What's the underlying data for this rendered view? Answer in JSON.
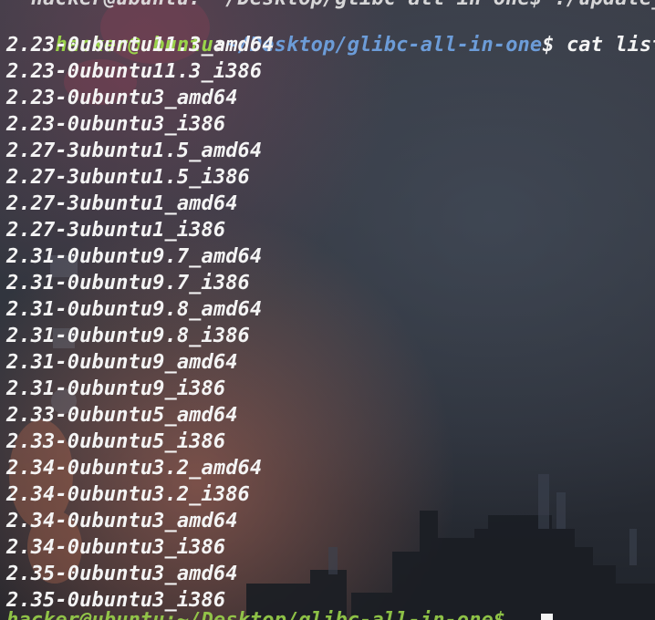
{
  "terminal": {
    "top_partial_line": "  hacker@ubuntu: ~/Desktop/glibc-all-in-one$ ./update_list",
    "prompt": {
      "user_host": "hacker@ubuntu",
      "colon": ":",
      "path": "~/Desktop/glibc-all-in-one",
      "symbol": "$",
      "command": " cat list"
    },
    "output": [
      "2.23-0ubuntu11.3_amd64",
      "2.23-0ubuntu11.3_i386",
      "2.23-0ubuntu3_amd64",
      "2.23-0ubuntu3_i386",
      "2.27-3ubuntu1.5_amd64",
      "2.27-3ubuntu1.5_i386",
      "2.27-3ubuntu1_amd64",
      "2.27-3ubuntu1_i386",
      "2.31-0ubuntu9.7_amd64",
      "2.31-0ubuntu9.7_i386",
      "2.31-0ubuntu9.8_amd64",
      "2.31-0ubuntu9.8_i386",
      "2.31-0ubuntu9_amd64",
      "2.31-0ubuntu9_i386",
      "2.33-0ubuntu5_amd64",
      "2.33-0ubuntu5_i386",
      "2.34-0ubuntu3.2_amd64",
      "2.34-0ubuntu3.2_i386",
      "2.34-0ubuntu3_amd64",
      "2.34-0ubuntu3_i386",
      "2.35-0ubuntu3_amd64",
      "2.35-0ubuntu3_i386"
    ],
    "bottom_partial_line": "hacker@ubuntu:~/Desktop/glibc-all-in-one$ "
  },
  "colors": {
    "user_host": "#9ad34a",
    "path": "#6c9cd8",
    "text": "#f4f4f4"
  }
}
